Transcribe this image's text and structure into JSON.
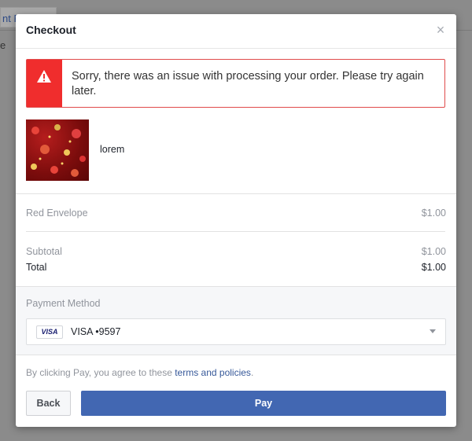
{
  "background": {
    "tab_label": "nt F",
    "side_char": "e"
  },
  "modal": {
    "title": "Checkout",
    "close_glyph": "×"
  },
  "error": {
    "icon": "warning-icon",
    "message": "Sorry, there was an issue with processing your order. Please try again later."
  },
  "product": {
    "name": "lorem",
    "image": "red-envelope-thumbnail"
  },
  "line_items": [
    {
      "label": "Red Envelope",
      "amount": "$1.00"
    }
  ],
  "summary": {
    "subtotal_label": "Subtotal",
    "subtotal_amount": "$1.00",
    "total_label": "Total",
    "total_amount": "$1.00"
  },
  "payment": {
    "label": "Payment Method",
    "card_brand": "VISA",
    "selected_value": "VISA •9597"
  },
  "terms": {
    "prefix": "By clicking Pay, you agree to these ",
    "link_text": "terms and policies",
    "suffix": "."
  },
  "actions": {
    "back_label": "Back",
    "pay_label": "Pay"
  },
  "colors": {
    "error_red": "#f02d2d",
    "primary_blue": "#4267b2",
    "link_blue": "#365899"
  }
}
